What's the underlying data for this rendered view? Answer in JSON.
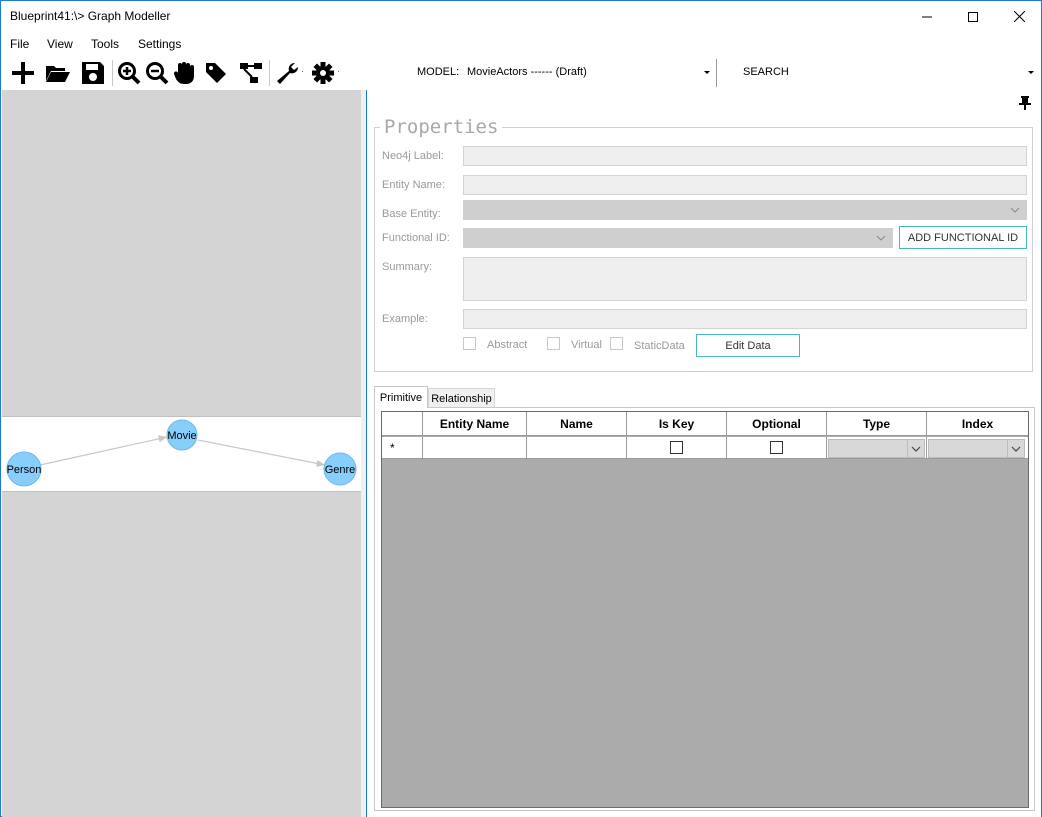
{
  "window": {
    "title": "Blueprint41:\\> Graph Modeller"
  },
  "menu": {
    "items": [
      "File",
      "View",
      "Tools",
      "Settings"
    ]
  },
  "toolbar": {
    "icons": [
      "add-icon",
      "open-folder-icon",
      "save-icon",
      "zoom-in-icon",
      "zoom-out-icon",
      "pan-hand-icon",
      "tag-icon",
      "hierarchy-icon",
      "wrench-icon",
      "gear-icon"
    ],
    "model_label": "MODEL:",
    "model_value": "MovieActors ------ (Draft)",
    "search_label": "SEARCH"
  },
  "graph": {
    "nodes": [
      "Person",
      "Movie",
      "Genre"
    ],
    "node_color": "#87cefa",
    "edges": [
      [
        "Person",
        "Movie"
      ],
      [
        "Movie",
        "Genre"
      ]
    ]
  },
  "properties": {
    "title": "Properties",
    "neo4j_label": "Neo4j Label:",
    "entity_name": "Entity Name:",
    "base_entity": "Base Entity:",
    "functional_id": "Functional ID:",
    "summary": "Summary:",
    "example": "Example:",
    "add_functional_id": "ADD FUNCTIONAL ID",
    "abstract": "Abstract",
    "virtual": "Virtual",
    "static_data": "StaticData",
    "edit_data": "Edit Data",
    "accent_color": "#4bb5c8"
  },
  "tabs": {
    "primitive": "Primitive",
    "relationship": "Relationship"
  },
  "grid": {
    "columns": [
      "Entity Name",
      "Name",
      "Is Key",
      "Optional",
      "Type",
      "Index"
    ],
    "new_row_marker": "*"
  }
}
